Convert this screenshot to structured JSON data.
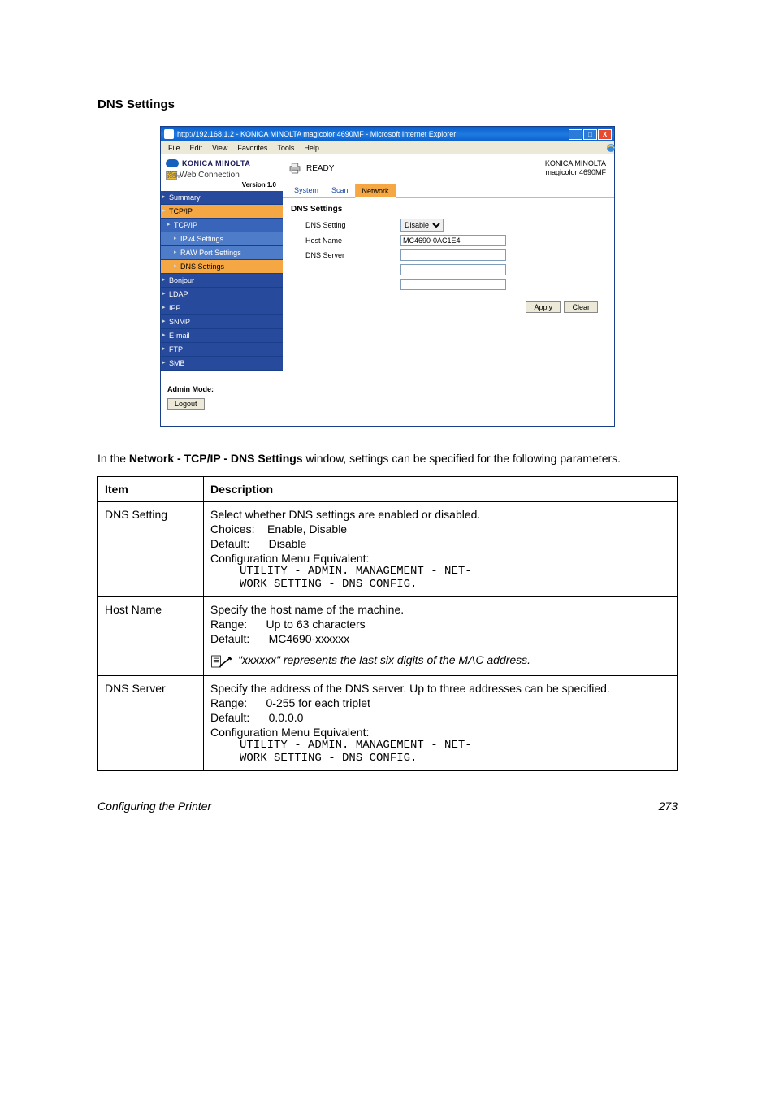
{
  "heading": "DNS Settings",
  "browser": {
    "title": "http://192.168.1.2 - KONICA MINOLTA magicolor 4690MF - Microsoft Internet Explorer",
    "menus": [
      "File",
      "Edit",
      "View",
      "Favorites",
      "Tools",
      "Help"
    ],
    "brand": "KONICA MINOLTA",
    "pscope_label": "Web Connection",
    "pscope_prefix": "PAGE SCOPE",
    "version": "Version 1.0",
    "device_line1": "KONICA MINOLTA",
    "device_line2": "magicolor 4690MF",
    "ready": "READY",
    "tabs": {
      "system": "System",
      "scan": "Scan",
      "network": "Network"
    },
    "nav": {
      "summary": "Summary",
      "tcpip": "TCP/IP",
      "tcpip2": "TCP/IP",
      "ipv4": "IPv4 Settings",
      "rawport": "RAW Port Settings",
      "dns": "DNS Settings",
      "bonjour": "Bonjour",
      "ldap": "LDAP",
      "ipp": "IPP",
      "snmp": "SNMP",
      "email": "E-mail",
      "ftp": "FTP",
      "smb": "SMB"
    },
    "admin_label": "Admin Mode:",
    "logout": "Logout",
    "pane": {
      "title": "DNS Settings",
      "dns_setting_label": "DNS Setting",
      "dns_setting_value": "Disable",
      "host_name_label": "Host Name",
      "host_name_value": "MC4690-0AC1E4",
      "dns_server_label": "DNS Server",
      "apply": "Apply",
      "clear": "Clear"
    }
  },
  "intro_pre": "In the ",
  "intro_bold": "Network - TCP/IP - DNS Settings",
  "intro_post": " window, settings can be specified for the following parameters.",
  "th_item": "Item",
  "th_desc": "Description",
  "rows": {
    "dns": {
      "item": "DNS Setting",
      "l1": "Select whether DNS settings are enabled or disabled.",
      "choices_k": "Choices:",
      "choices_v": "Enable, Disable",
      "default_k": "Default:",
      "default_v": "Disable",
      "cfg": "Configuration Menu Equivalent:",
      "cfgline1": "UTILITY - ADMIN. MANAGEMENT - NET-",
      "cfgline2": "WORK SETTING - DNS CONFIG."
    },
    "host": {
      "item": "Host Name",
      "l1": "Specify the host name of the machine.",
      "range_k": "Range:",
      "range_v": "Up to 63 characters",
      "default_k": "Default:",
      "default_v": "MC4690-xxxxxx",
      "note": "\"xxxxxx\" represents the last six digits of the MAC address."
    },
    "srv": {
      "item": "DNS Server",
      "l1": "Specify the address of the DNS server. Up to three addresses can be specified.",
      "range_k": "Range:",
      "range_v": "0-255 for each triplet",
      "default_k": "Default:",
      "default_v": "0.0.0.0",
      "cfg": "Configuration Menu Equivalent:",
      "cfgline1": "UTILITY - ADMIN. MANAGEMENT - NET-",
      "cfgline2": "WORK SETTING - DNS CONFIG."
    }
  },
  "footer_title": "Configuring the Printer",
  "footer_page": "273"
}
